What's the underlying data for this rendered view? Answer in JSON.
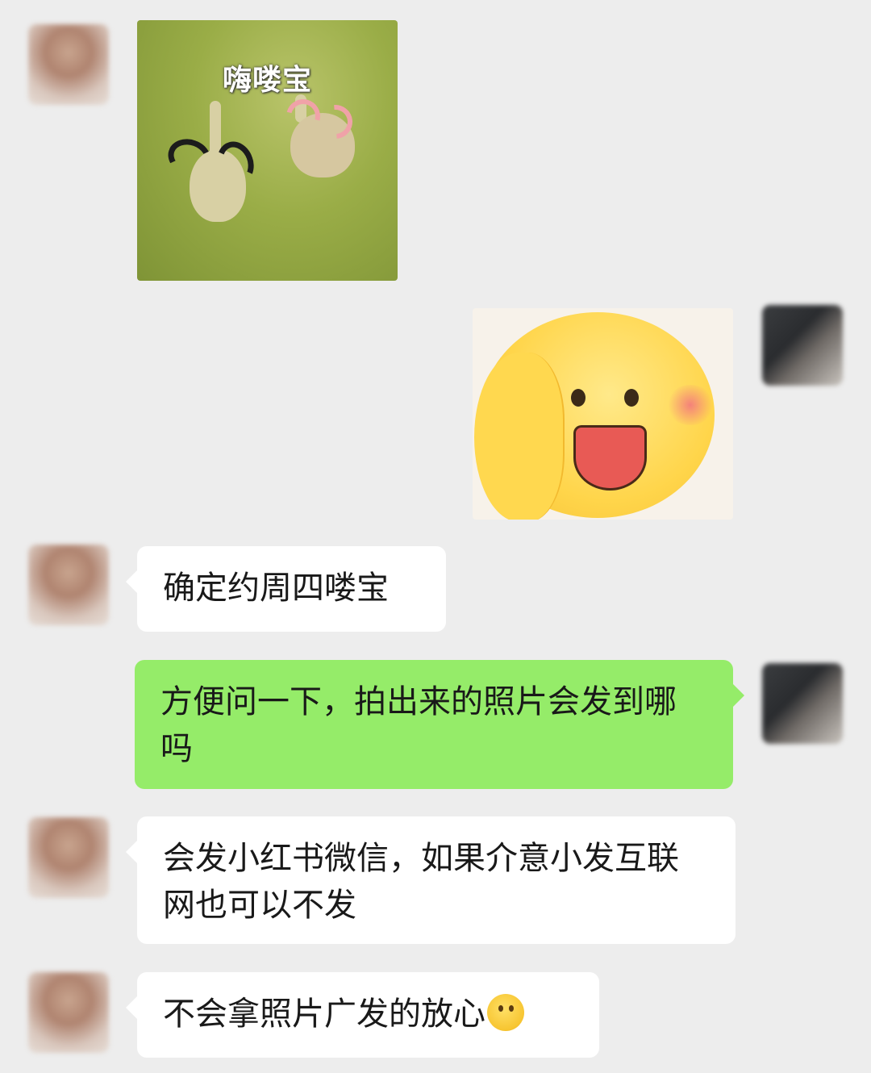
{
  "chat": {
    "messages": [
      {
        "sender": "friend",
        "type": "sticker",
        "sticker_icon": "ducks-waving-sticker",
        "caption": "嗨喽宝"
      },
      {
        "sender": "me",
        "type": "sticker",
        "sticker_icon": "smiley-face-sticker"
      },
      {
        "sender": "friend",
        "type": "text",
        "text": "确定约周四喽宝"
      },
      {
        "sender": "me",
        "type": "text",
        "text": "方便问一下，拍出来的照片会发到哪吗"
      },
      {
        "sender": "friend",
        "type": "text",
        "text": "会发小红书微信，如果介意小发互联网也可以不发"
      },
      {
        "sender": "friend",
        "type": "text",
        "text": "不会拿照片广发的放心",
        "emoji": "thinking-face-emoji"
      }
    ]
  },
  "colors": {
    "background": "#ededed",
    "bubble_friend": "#ffffff",
    "bubble_me": "#95ec69",
    "text": "#191919"
  }
}
